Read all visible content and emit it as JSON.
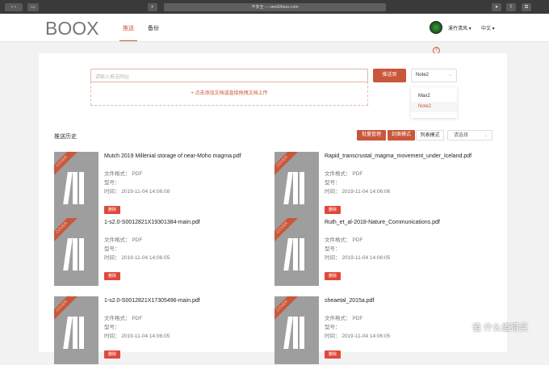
{
  "browser": {
    "url": "不安全 — send2boox.com"
  },
  "header": {
    "logo": "BOOX",
    "tabs": [
      {
        "label": "推送",
        "active": true
      },
      {
        "label": "备份",
        "active": false
      }
    ],
    "user": "溪竹清风 ▾",
    "language": "中文 ▾"
  },
  "push": {
    "help": "?",
    "placeholder": "请输入推送网址",
    "push_label": "推送到",
    "device": "Note2",
    "upload_label": "+ 点击添加文档或直接拖拽文档上传",
    "device_options": [
      "Max2",
      "Note2"
    ]
  },
  "history": {
    "title": "推送历史",
    "batch_label": "批量管理",
    "cover_label": "封面模式",
    "list_label": "列表模式",
    "sort_placeholder": "请选择",
    "format_label": "文件格式：",
    "model_label": "型号：",
    "time_label": "时间：",
    "delete_label": "删除",
    "cover_text": "COVER",
    "items": [
      {
        "title": "Mutch 2019 Millenial storage of near-Moho magma.pdf",
        "format": "PDF",
        "model": "",
        "time": "2019-11-04 14:06:08"
      },
      {
        "title": "Rapid_transcrustal_magma_movement_under_Iceland.pdf",
        "format": "PDF",
        "model": "",
        "time": "2019-11-04 14:06:06"
      },
      {
        "title": "1-s2.0-S0012821X19301384-main.pdf",
        "format": "PDF",
        "model": "",
        "time": "2019-11-04 14:06:05"
      },
      {
        "title": "Ruth_et_al-2018-Nature_Communications.pdf",
        "format": "PDF",
        "model": "",
        "time": "2019-11-04 14:06:05"
      },
      {
        "title": "1-s2.0-S0012821X17305496-main.pdf",
        "format": "PDF",
        "model": "",
        "time": "2019-11-04 14:06:05"
      },
      {
        "title": "sheaetal_2015a.pdf",
        "format": "PDF",
        "model": "",
        "time": "2019-11-04 14:06:05"
      }
    ]
  },
  "watermark": "值 什么值得买"
}
